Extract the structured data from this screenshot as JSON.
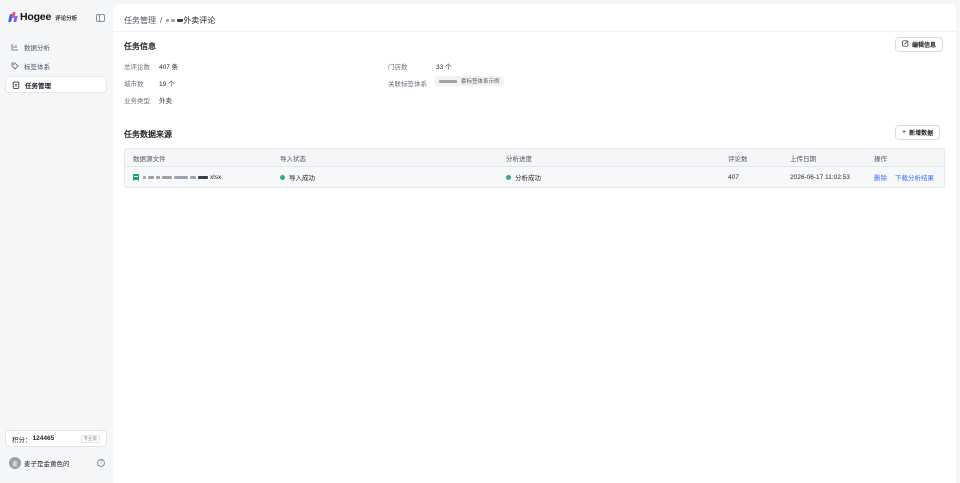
{
  "app": {
    "brand": "Hogee",
    "subtitle": "评论分析"
  },
  "sidebar": {
    "items": [
      {
        "label": "数据分析",
        "icon": "chart-icon",
        "active": false
      },
      {
        "label": "标签体系",
        "icon": "tag-icon",
        "active": false
      },
      {
        "label": "任务管理",
        "icon": "clipboard-icon",
        "active": true
      }
    ],
    "points_label": "积分：",
    "points_value": "124465",
    "points_tag": "专业版",
    "user_initial": "麦",
    "user_name": "麦子是金黄色的"
  },
  "breadcrumb": {
    "parent": "任务管理",
    "separator": "/",
    "current": "外卖评论"
  },
  "task_info": {
    "title": "任务信息",
    "edit_button": "编辑信息",
    "fields": {
      "total_reviews_label": "总评论数",
      "total_reviews_value": "407 条",
      "store_count_label": "门店数",
      "store_count_value": "33 个",
      "city_count_label": "城市数",
      "city_count_value": "19 个",
      "tag_system_label": "关联标签体系",
      "tag_system_value": "套标签体系示例",
      "business_type_label": "业务类型",
      "business_type_value": "外卖"
    }
  },
  "data_sources": {
    "title": "任务数据来源",
    "add_button": "新增数据",
    "columns": [
      "数据源文件",
      "导入状态",
      "分析进度",
      "评论数",
      "上传日期",
      "操作"
    ],
    "rows": [
      {
        "file_suffix": "xlsx",
        "import_status": "导入成功",
        "analysis_status": "分析成功",
        "review_count": "407",
        "upload_date": "2026-06-17 11:02:53",
        "action_delete": "删除",
        "action_download": "下载分析结果"
      }
    ]
  },
  "colors": {
    "accent": "#3370ff",
    "success": "#2fb36d",
    "brand_blue": "#2f6bff",
    "brand_pink": "#ff4d6d"
  }
}
